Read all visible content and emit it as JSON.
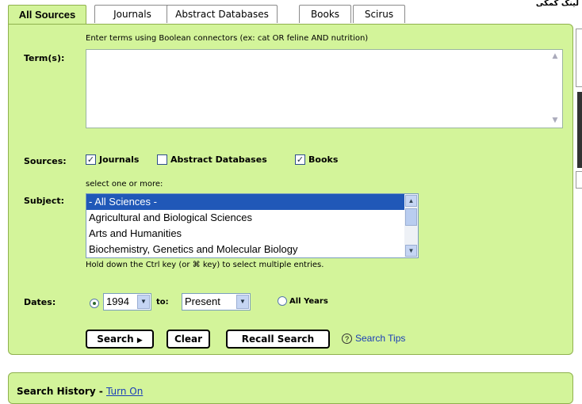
{
  "corner_text": "لینک کمکی",
  "tabs": [
    {
      "label": "All Sources",
      "active": true
    },
    {
      "label": "Journals",
      "active": false
    },
    {
      "label": "Abstract Databases",
      "active": false
    },
    {
      "label": "Books",
      "active": false
    },
    {
      "label": "Scirus",
      "active": false
    }
  ],
  "terms": {
    "label": "Term(s):",
    "hint": "Enter terms using Boolean connectors (ex: cat OR feline AND nutrition)",
    "value": ""
  },
  "sources": {
    "label": "Sources:",
    "items": [
      {
        "label": "Journals",
        "checked": true
      },
      {
        "label": "Abstract Databases",
        "checked": false
      },
      {
        "label": "Books",
        "checked": true
      }
    ]
  },
  "subject": {
    "label": "Subject:",
    "hint": "select one or more:",
    "options": [
      {
        "label": "- All Sciences -",
        "selected": true
      },
      {
        "label": "Agricultural and Biological Sciences",
        "selected": false
      },
      {
        "label": "Arts and Humanities",
        "selected": false
      },
      {
        "label": "Biochemistry, Genetics and Molecular Biology",
        "selected": false
      }
    ],
    "footer_hint": "Hold down the Ctrl key (or ⌘ key) to select multiple entries."
  },
  "dates": {
    "label": "Dates:",
    "from_value": "1994",
    "to_label": "to:",
    "to_value": "Present",
    "all_years_label": "All Years",
    "range_selected": true
  },
  "buttons": {
    "search": "Search",
    "clear": "Clear",
    "recall": "Recall Search"
  },
  "search_tips": "Search Tips",
  "history": {
    "title": "Search History",
    "separator": " - ",
    "link": "Turn On"
  },
  "colors": {
    "panel_bg": "#d3f49a",
    "link": "#1a3db8",
    "selected_option": "#2058b8"
  }
}
